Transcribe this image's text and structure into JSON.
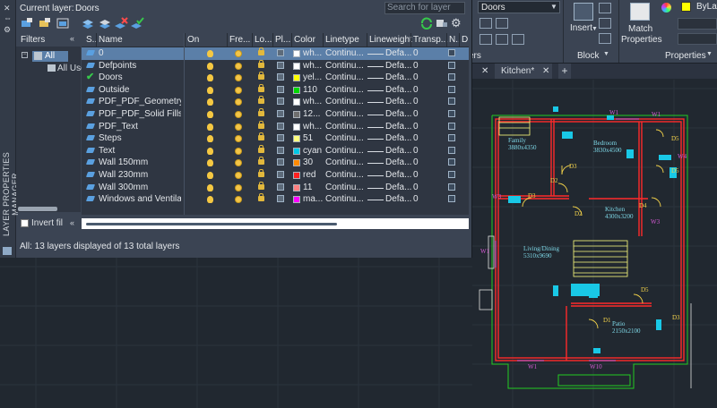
{
  "palette": {
    "vertical_title": "LAYER PROPERTIES MANAGER",
    "current_layer_label": "Current layer:",
    "current_layer_value": "Doors",
    "search_placeholder": "Search for layer",
    "filters": {
      "header": "Filters",
      "all": "All",
      "all_used": "All Use",
      "invert_label": "Invert fil"
    },
    "columns": [
      "S..",
      "Name",
      "On",
      "Fre...",
      "Lo...",
      "Pl...",
      "Color",
      "Linetype",
      "Lineweight",
      "Transp...",
      "N..",
      "D"
    ],
    "layers": [
      {
        "name": "0",
        "color": "wh...",
        "swatch": "#ffffff",
        "linetype": "Continu...",
        "lineweight": "Defa...",
        "transparency": "0",
        "selected": true,
        "current": false
      },
      {
        "name": "Defpoints",
        "color": "wh...",
        "swatch": "#ffffff",
        "linetype": "Continu...",
        "lineweight": "Defa...",
        "transparency": "0",
        "selected": false,
        "current": false
      },
      {
        "name": "Doors",
        "color": "yel...",
        "swatch": "#ffff00",
        "linetype": "Continu...",
        "lineweight": "Defa...",
        "transparency": "0",
        "selected": false,
        "current": true
      },
      {
        "name": "Outside",
        "color": "110",
        "swatch": "#00d800",
        "linetype": "Continu...",
        "lineweight": "Defa...",
        "transparency": "0",
        "selected": false,
        "current": false
      },
      {
        "name": "PDF_PDF_Geometry",
        "color": "wh...",
        "swatch": "#ffffff",
        "linetype": "Continu...",
        "lineweight": "Defa...",
        "transparency": "0",
        "selected": false,
        "current": false
      },
      {
        "name": "PDF_PDF_Solid Fills",
        "color": "12...",
        "swatch": "#6f6f6f",
        "linetype": "Continu...",
        "lineweight": "Defa...",
        "transparency": "0",
        "selected": false,
        "current": false
      },
      {
        "name": "PDF_Text",
        "color": "wh...",
        "swatch": "#ffffff",
        "linetype": "Continu...",
        "lineweight": "Defa...",
        "transparency": "0",
        "selected": false,
        "current": false
      },
      {
        "name": "Steps",
        "color": "51",
        "swatch": "#ffff7f",
        "linetype": "Continu...",
        "lineweight": "Defa...",
        "transparency": "0",
        "selected": false,
        "current": false
      },
      {
        "name": "Text",
        "color": "cyan",
        "swatch": "#00c8e6",
        "linetype": "Continu...",
        "lineweight": "Defa...",
        "transparency": "0",
        "selected": false,
        "current": false
      },
      {
        "name": "Wall 150mm",
        "color": "30",
        "swatch": "#ff8a00",
        "linetype": "Continu...",
        "lineweight": "Defa...",
        "transparency": "0",
        "selected": false,
        "current": false
      },
      {
        "name": "Wall 230mm",
        "color": "red",
        "swatch": "#ff2020",
        "linetype": "Continu...",
        "lineweight": "Defa...",
        "transparency": "0",
        "selected": false,
        "current": false
      },
      {
        "name": "Wall 300mm",
        "color": "11",
        "swatch": "#ff8080",
        "linetype": "Continu...",
        "lineweight": "Defa...",
        "transparency": "0",
        "selected": false,
        "current": false
      },
      {
        "name": "Windows and Ventila...",
        "color": "ma...",
        "swatch": "#ff00ff",
        "linetype": "Continu...",
        "lineweight": "Defa...",
        "transparency": "0",
        "selected": false,
        "current": false
      }
    ],
    "status": "All: 13 layers displayed of 13 total layers"
  },
  "ribbon": {
    "layer_combo_value": "Doors",
    "layers_footer": "ers",
    "insert_label": "Insert",
    "block_footer": "Block",
    "match_label_1": "Match",
    "match_label_2": "Properties",
    "bylayer_value": "ByLay",
    "properties_footer": "Properties",
    "bylayer_swatch": "#ffff00"
  },
  "file_tabs": [
    {
      "label": "Kitchen*"
    }
  ],
  "drawing": {
    "rooms": [
      {
        "name": "Family",
        "size": "3880x4350"
      },
      {
        "name": "Bedroom",
        "size": "3830x4500"
      },
      {
        "name": "Kitchen",
        "size": "4300x3200"
      },
      {
        "name": "Living/Dining",
        "size": "5310x9690"
      },
      {
        "name": "Patio",
        "size": "2150x2100"
      }
    ],
    "door_tags": [
      "D5",
      "D5",
      "D3",
      "D2",
      "D3",
      "D4",
      "D2",
      "D5",
      "D1",
      "D3"
    ],
    "window_tags": [
      "W1",
      "W1",
      "W3",
      "W3",
      "W4",
      "W1",
      "W10",
      "W1"
    ]
  }
}
